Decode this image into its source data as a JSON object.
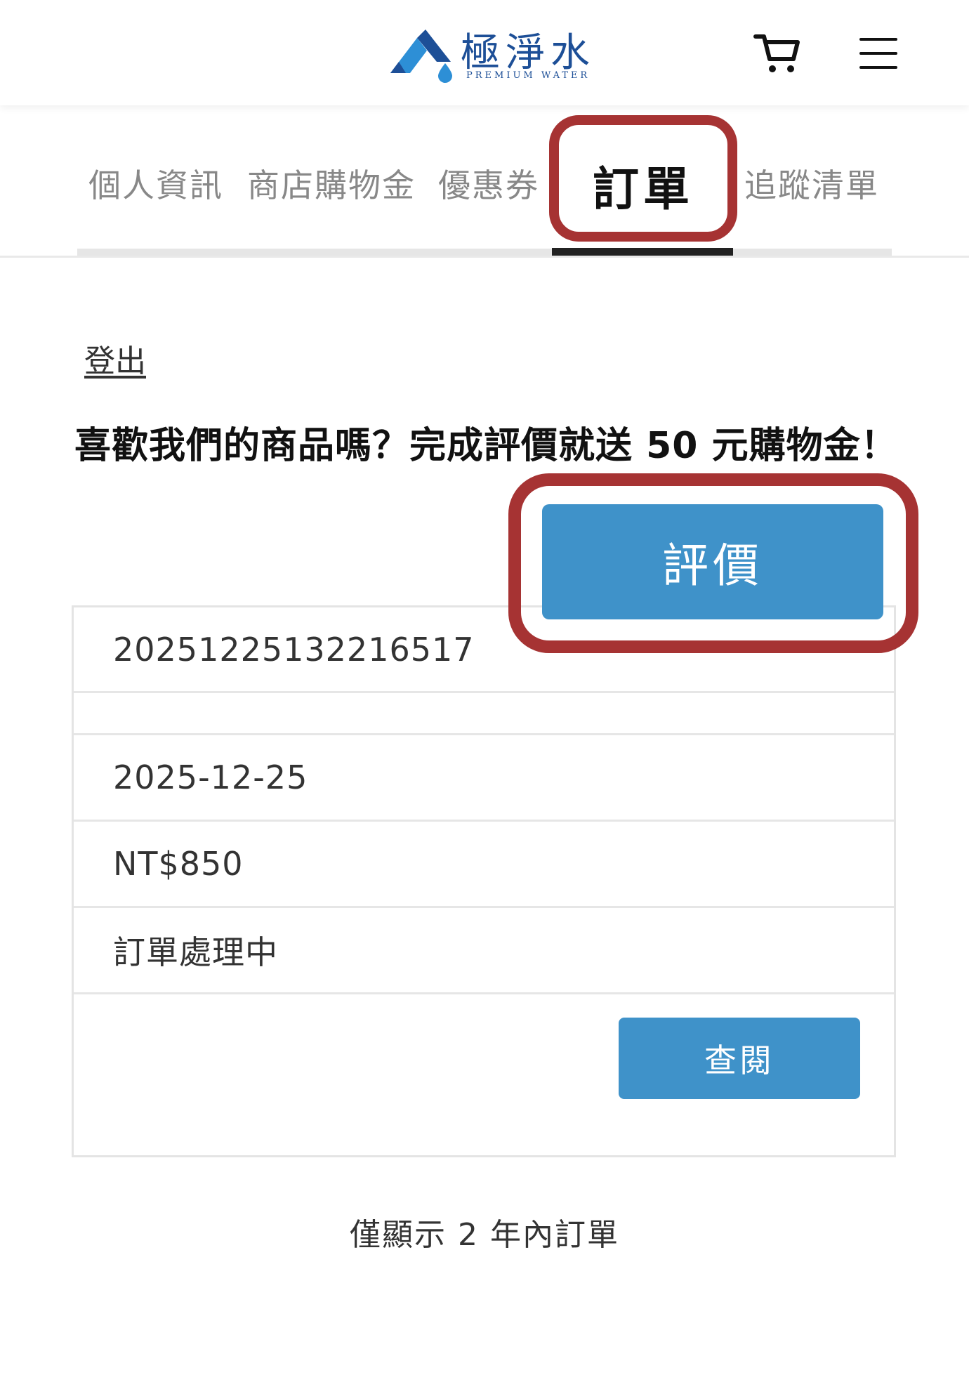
{
  "header": {
    "brand_cn": "極淨水",
    "brand_en": "PREMIUM WATER",
    "logo_colors": {
      "brand": "#1d4f97",
      "accent": "#2d8fd6"
    }
  },
  "tabs": [
    {
      "label": "個人資訊",
      "active": false
    },
    {
      "label": "商店購物金",
      "active": false
    },
    {
      "label": "優惠券",
      "active": false
    },
    {
      "label": "訂單",
      "active": true
    },
    {
      "label": "追蹤清單",
      "active": false
    }
  ],
  "account": {
    "logout_label": "登出"
  },
  "promo": {
    "text": "喜歡我們的商品嗎？完成評價就送 50 元購物金！",
    "review_button_label": "評價"
  },
  "order": {
    "number": "20251225132216517",
    "date": "2025-12-25",
    "total": "NT$850",
    "status": "訂單處理中",
    "view_button_label": "查閱"
  },
  "footer": {
    "note": "僅顯示 2 年內訂單"
  },
  "colors": {
    "button": "#3f92c9",
    "highlight": "#a63333",
    "active_tab_underline": "#222222"
  },
  "icons": {
    "cart": "cart-icon",
    "menu": "hamburger-menu-icon"
  }
}
